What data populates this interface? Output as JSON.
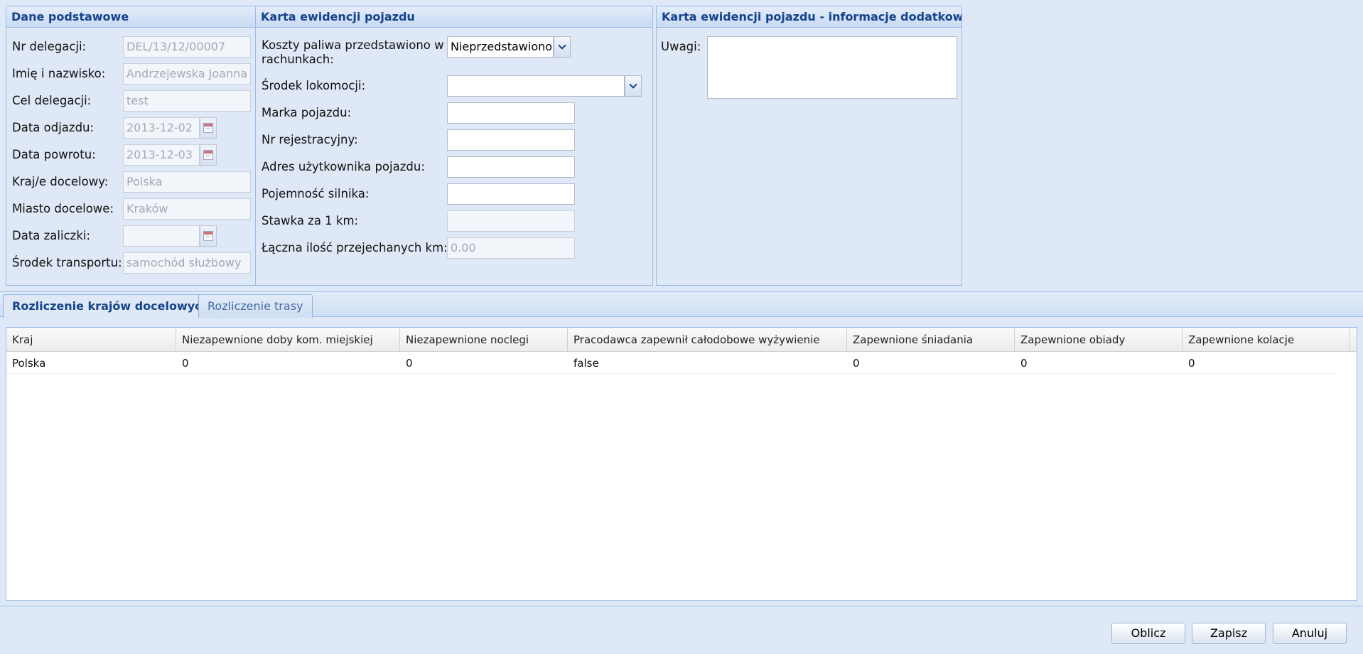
{
  "basic": {
    "title": "Dane podstawowe",
    "fields": [
      {
        "label": "Nr delegacji:",
        "value": "DEL/13/12/00007"
      },
      {
        "label": "Imię i nazwisko:",
        "value": "Andrzejewska Joanna"
      },
      {
        "label": "Cel delegacji:",
        "value": "test"
      },
      {
        "label": "Data odjazdu:",
        "value": "2013-12-02"
      },
      {
        "label": "Data powrotu:",
        "value": "2013-12-03"
      },
      {
        "label": "Kraj/e docelowy:",
        "value": "Polska"
      },
      {
        "label": "Miasto docelowe:",
        "value": "Kraków"
      },
      {
        "label": "Data zaliczki:",
        "value": ""
      },
      {
        "label": "Środek transportu:",
        "value": "samochód służbowy"
      }
    ]
  },
  "vehicle": {
    "title": "Karta ewidencji pojazdu",
    "fuel_label_line1": "Koszty paliwa przedstawiono w",
    "fuel_label_line2": "rachunkach:",
    "fuel_value": "Nieprzedstawiono",
    "fields": [
      {
        "label": "Środek lokomocji:",
        "value": ""
      },
      {
        "label": "Marka pojazdu:",
        "value": ""
      },
      {
        "label": "Nr rejestracyjny:",
        "value": ""
      },
      {
        "label": "Adres użytkownika pojazdu:",
        "value": ""
      },
      {
        "label": "Pojemność silnika:",
        "value": ""
      },
      {
        "label": "Stawka za 1 km:",
        "value": ""
      },
      {
        "label": "Łączna ilość przejechanych km:",
        "value": "0.00"
      }
    ]
  },
  "extra": {
    "title": "Karta ewidencji pojazdu - informacje dodatkowe",
    "notes_label": "Uwagi:",
    "notes_value": ""
  },
  "tabs": [
    {
      "label": "Rozliczenie krajów docelowych",
      "active": true
    },
    {
      "label": "Rozliczenie trasy",
      "active": false
    }
  ],
  "grid": {
    "columns": [
      "Kraj",
      "Niezapewnione doby kom. miejskiej",
      "Niezapewnione noclegi",
      "Pracodawca zapewnił całodobowe wyżywienie",
      "Zapewnione śniadania",
      "Zapewnione obiady",
      "Zapewnione kolacje"
    ],
    "rows": [
      [
        "Polska",
        "0",
        "0",
        "false",
        "0",
        "0",
        "0"
      ]
    ]
  },
  "buttons": {
    "calculate": "Oblicz",
    "save": "Zapisz",
    "cancel": "Anuluj"
  }
}
